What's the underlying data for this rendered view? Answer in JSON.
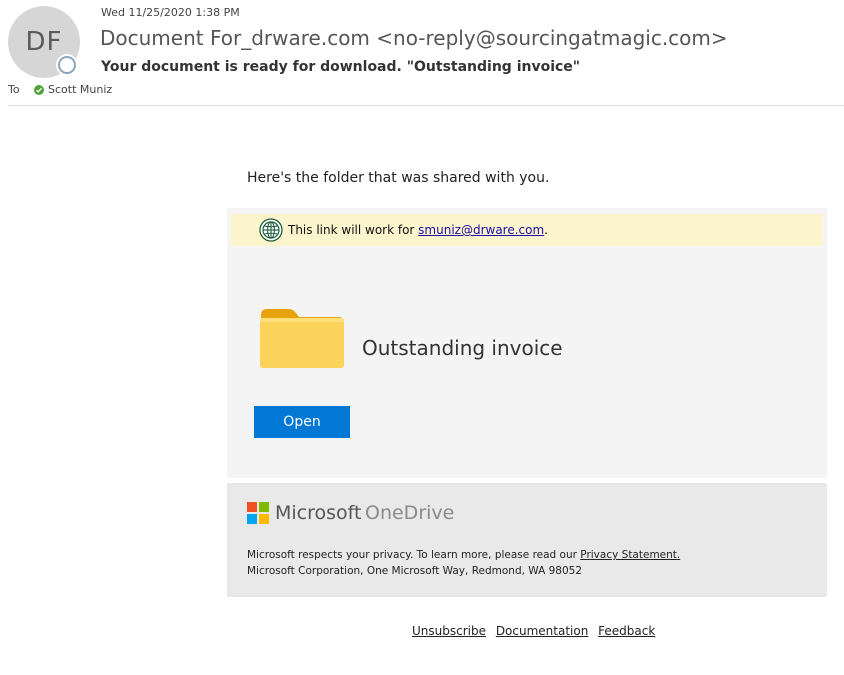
{
  "header": {
    "avatar_initials": "DF",
    "date": "Wed 11/25/2020 1:38 PM",
    "from": "Document For_drware.com <no-reply@sourcingatmagic.com>",
    "subject": "Your document is ready for download. \"Outstanding invoice\"",
    "to_label": "To",
    "recipient": "Scott Muniz",
    "recipient_status_color": "#53a33a"
  },
  "body": {
    "intro": "Here's the folder that was shared with you.",
    "notice_prefix": "This link will work for ",
    "notice_email": "smuniz@drware.com",
    "notice_suffix": ".",
    "folder_name": "Outstanding invoice",
    "open_label": "Open",
    "accent_color": "#0078d4"
  },
  "footer": {
    "brand_microsoft": "Microsoft",
    "brand_onedrive": "OneDrive",
    "privacy_prefix": "Microsoft respects your privacy. To learn more, please read our ",
    "privacy_link": "Privacy Statement.",
    "address": "Microsoft Corporation, One Microsoft Way, Redmond, WA 98052"
  },
  "links": {
    "unsubscribe": "Unsubscribe",
    "documentation": "Documentation",
    "feedback": "Feedback"
  },
  "icons": {
    "presence": "presence-status-icon",
    "recipient_status": "check-circle-icon",
    "notice": "globe-icon",
    "folder": "folder-icon",
    "logo": "microsoft-logo-icon"
  }
}
